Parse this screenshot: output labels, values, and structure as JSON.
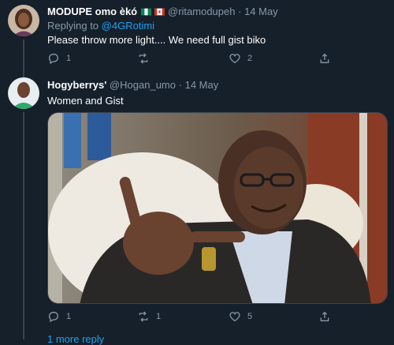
{
  "tweets": [
    {
      "name": "MODUPE omo èkó",
      "handle": "@ritamodupeh",
      "separator": "·",
      "date": "14 May",
      "replying_prefix": "Replying to",
      "replying_to": "@4GRotimi",
      "text": "Please throw more light.... We need full gist biko",
      "reply_count": "1",
      "retweet_count": "",
      "like_count": "2"
    },
    {
      "name": "Hogyberrys'",
      "handle": "@Hogan_umo",
      "separator": "·",
      "date": "14 May",
      "text": "Women and Gist",
      "reply_count": "1",
      "retweet_count": "1",
      "like_count": "5",
      "more_replies": "1 more reply"
    }
  ],
  "icons": {
    "reply": "reply-icon",
    "retweet": "retweet-icon",
    "like": "heart-icon",
    "share": "share-icon"
  },
  "colors": {
    "background": "#15202b",
    "text": "#ffffff",
    "muted": "#8899a6",
    "link": "#1da1f2",
    "border": "#38444d"
  }
}
